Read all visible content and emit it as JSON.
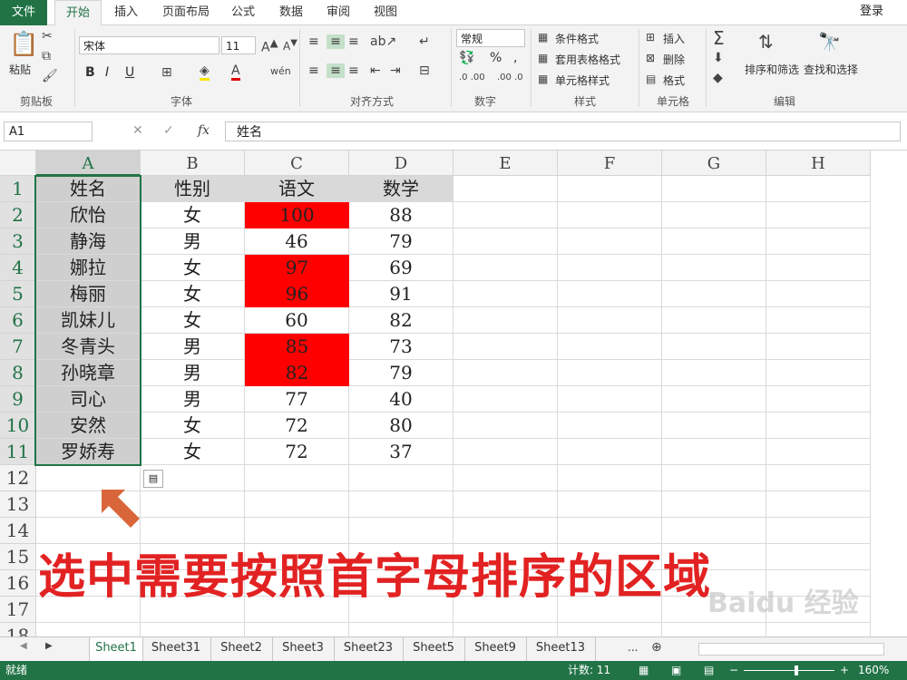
{
  "ribbon_tabs": [
    "文件",
    "开始",
    "插入",
    "页面布局",
    "公式",
    "数据",
    "审阅",
    "视图"
  ],
  "login": "登录",
  "clipboard": {
    "paste": "粘贴",
    "label": "剪贴板"
  },
  "font": {
    "name": "宋体",
    "size": "11",
    "bold": "B",
    "italic": "I",
    "underline": "U",
    "label": "字体"
  },
  "alignment": {
    "label": "对齐方式"
  },
  "number": {
    "format": "常规",
    "percent": "%",
    "comma": ",",
    "label": "数字"
  },
  "styles": {
    "conditional": "条件格式",
    "table": "套用表格格式",
    "cell": "单元格样式",
    "label": "样式"
  },
  "cells": {
    "insert": "插入",
    "delete": "删除",
    "format": "格式",
    "label": "单元格"
  },
  "editing": {
    "sort": "排序和筛选",
    "find": "查找和选择",
    "label": "编辑"
  },
  "namebox": "A1",
  "formula": "姓名",
  "fx": "fx",
  "columns": [
    "A",
    "B",
    "C",
    "D",
    "E",
    "F",
    "G",
    "H"
  ],
  "row_numbers": [
    "1",
    "2",
    "3",
    "4",
    "5",
    "6",
    "7",
    "8",
    "9",
    "10",
    "11",
    "12",
    "13",
    "14",
    "15",
    "16",
    "17",
    "18"
  ],
  "table": {
    "headers": [
      "姓名",
      "性别",
      "语文",
      "数学"
    ],
    "rows": [
      [
        "欣怡",
        "女",
        "100",
        "88"
      ],
      [
        "静海",
        "男",
        "46",
        "79"
      ],
      [
        "娜拉",
        "女",
        "97",
        "69"
      ],
      [
        "梅丽",
        "女",
        "96",
        "91"
      ],
      [
        "凯妹儿",
        "女",
        "60",
        "82"
      ],
      [
        "冬青头",
        "男",
        "85",
        "73"
      ],
      [
        "孙晓章",
        "男",
        "82",
        "79"
      ],
      [
        "司心",
        "男",
        "77",
        "40"
      ],
      [
        "安然",
        "女",
        "72",
        "80"
      ],
      [
        "罗娇寿",
        "女",
        "72",
        "37"
      ]
    ],
    "highlighted_rows": [
      0,
      2,
      3,
      5,
      6
    ],
    "highlight_color": "#ff0000"
  },
  "annotation": "选中需要按照首字母排序的区域",
  "annotation_color": "#e22222",
  "sheets": [
    "Sheet1",
    "Sheet31",
    "Sheet2",
    "Sheet3",
    "Sheet23",
    "Sheet5",
    "Sheet9",
    "Sheet13"
  ],
  "sheets_more": "...",
  "status": {
    "ready": "就绪",
    "count": "计数: 11",
    "zoom": "160%"
  },
  "watermark": "Baidu 经验",
  "accent_color": "#217346"
}
